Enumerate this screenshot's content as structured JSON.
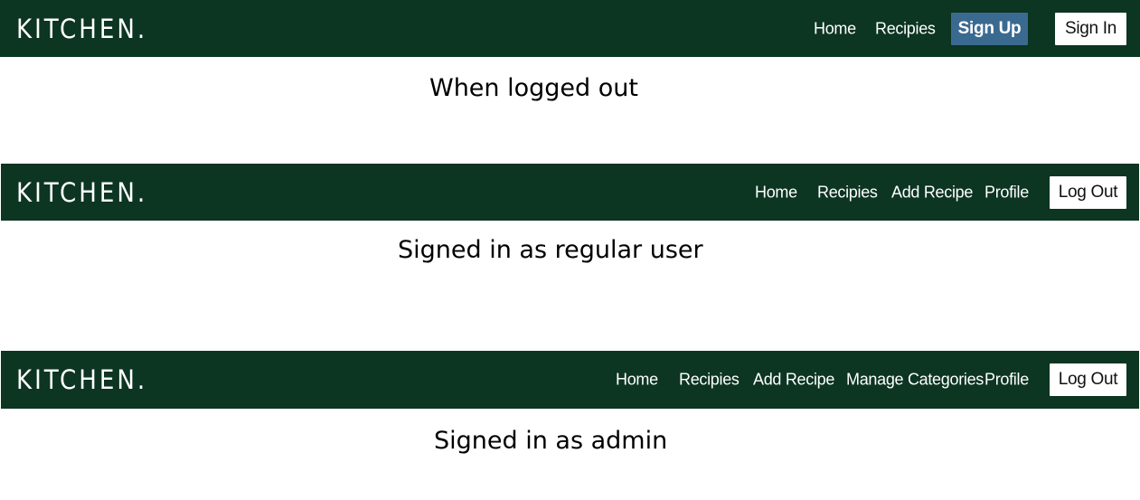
{
  "nav_logged_out": {
    "brand": "KITCHEN.",
    "links": {
      "home": "Home",
      "recipes": "Recipies"
    },
    "sign_up": "Sign Up",
    "sign_in": "Sign In"
  },
  "caption_logged_out": "When logged out",
  "nav_regular_user": {
    "brand": "KITCHEN.",
    "links": {
      "home": "Home",
      "recipes": "Recipies",
      "add_recipe": "Add Recipe",
      "profile": "Profile"
    },
    "log_out": "Log Out"
  },
  "caption_regular_user": "Signed in as regular user",
  "nav_admin": {
    "brand": "KITCHEN.",
    "links": {
      "home": "Home",
      "recipes": "Recipies",
      "add_recipe": "Add Recipe",
      "manage_categories": "Manage Categories",
      "profile": "Profile"
    },
    "log_out": "Log Out"
  },
  "caption_admin": "Signed in as admin",
  "colors": {
    "navbar_bg": "#0c3522",
    "sign_up_bg": "#3b6a90",
    "button_white": "#ffffff",
    "text": "#000000"
  }
}
